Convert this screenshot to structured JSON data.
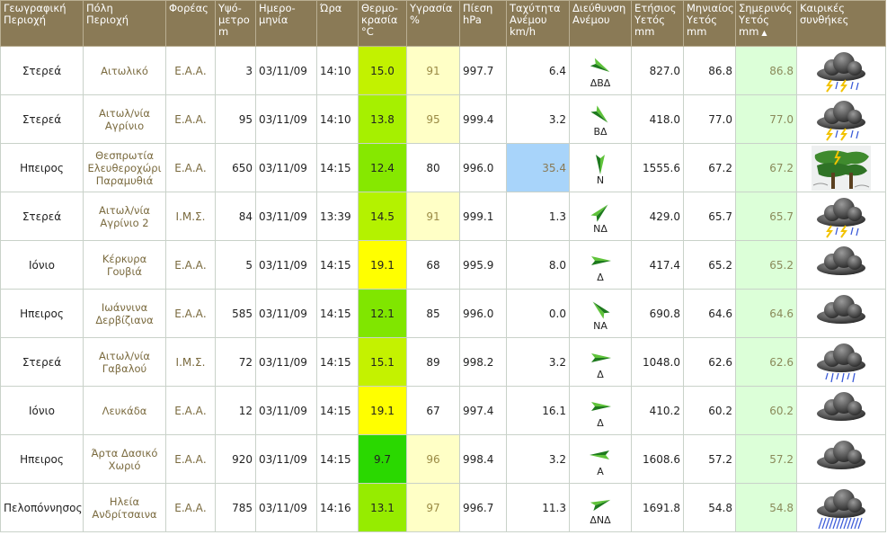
{
  "headers": [
    {
      "l1": "Γεωγραφική",
      "l2": "Περιοχή"
    },
    {
      "l1": "Πόλη",
      "l2": "Περιοχή"
    },
    {
      "l1": "Φορέας",
      "l2": ""
    },
    {
      "l1": "Υψό-",
      "l2": "μετρο",
      "l3": "m"
    },
    {
      "l1": "Ημερο-",
      "l2": "μηνία"
    },
    {
      "l1": "Ώρα",
      "l2": ""
    },
    {
      "l1": "Θερμο-",
      "l2": "κρασία",
      "l3": "°C"
    },
    {
      "l1": "Υγρασία",
      "l2": "",
      "l3": "%"
    },
    {
      "l1": "Πίεση",
      "l2": "",
      "l3": "hPa"
    },
    {
      "l1": "Ταχύτητα",
      "l2": "Ανέμου",
      "l3": "km/h"
    },
    {
      "l1": "Διεύθυνση",
      "l2": "Ανέμου"
    },
    {
      "l1": "Ετήσιος",
      "l2": "Υετός",
      "l3": "mm"
    },
    {
      "l1": "Μηνιαίος",
      "l2": "Υετός",
      "l3": "mm"
    },
    {
      "l1": "Σημερινός",
      "l2": "Υετός",
      "l3": "mm",
      "arrow": "▲"
    },
    {
      "l1": "Καιρικές",
      "l2": "συνθήκες"
    }
  ],
  "rows": [
    {
      "region": "Στερεά",
      "city": "Αιτωλικό",
      "agency": "Ε.Α.Α.",
      "alt": "3",
      "date": "03/11/09",
      "time": "14:10",
      "temp": "15.0",
      "tempColor": "#c2f200",
      "hum": "91",
      "humHi": true,
      "pres": "997.7",
      "wind": "6.4",
      "windHi": false,
      "dir": "ΔΒΔ",
      "dirDeg": 300,
      "yearly": "827.0",
      "monthly": "86.8",
      "today": "86.8",
      "wx": "storm"
    },
    {
      "region": "Στερεά",
      "city": "Αιτωλ/νία Αγρίνιο",
      "agency": "Ε.Α.Α.",
      "alt": "95",
      "date": "03/11/09",
      "time": "14:10",
      "temp": "13.8",
      "tempColor": "#a6f000",
      "hum": "95",
      "humHi": true,
      "pres": "999.4",
      "wind": "3.2",
      "windHi": false,
      "dir": "ΒΔ",
      "dirDeg": 315,
      "yearly": "418.0",
      "monthly": "77.0",
      "today": "77.0",
      "wx": "storm"
    },
    {
      "region": "Ηπειρος",
      "city": "Θεσπρωτία Ελευθεροχώρι Παραμυθιά",
      "agency": "Ε.Α.Α.",
      "alt": "650",
      "date": "03/11/09",
      "time": "14:15",
      "temp": "12.4",
      "tempColor": "#86e800",
      "hum": "80",
      "humHi": false,
      "pres": "996.0",
      "wind": "35.4",
      "windHi": true,
      "dir": "Ν",
      "dirDeg": 0,
      "yearly": "1555.6",
      "monthly": "67.2",
      "today": "67.2",
      "wx": "windstorm"
    },
    {
      "region": "Στερεά",
      "city": "Αιτωλ/νία Αγρίνιο 2",
      "agency": "Ι.Μ.Σ.",
      "alt": "84",
      "date": "03/11/09",
      "time": "13:39",
      "temp": "14.5",
      "tempColor": "#b4f200",
      "hum": "91",
      "humHi": true,
      "pres": "999.1",
      "wind": "1.3",
      "windHi": false,
      "dir": "ΝΔ",
      "dirDeg": 225,
      "yearly": "429.0",
      "monthly": "65.7",
      "today": "65.7",
      "wx": "storm"
    },
    {
      "region": "Ιόνιο",
      "city": "Κέρκυρα Γουβιά",
      "agency": "Ε.Α.Α.",
      "alt": "5",
      "date": "03/11/09",
      "time": "14:15",
      "temp": "19.1",
      "tempColor": "#ffff00",
      "hum": "68",
      "humHi": false,
      "pres": "995.9",
      "wind": "8.0",
      "windHi": false,
      "dir": "Δ",
      "dirDeg": 270,
      "yearly": "417.4",
      "monthly": "65.2",
      "today": "65.2",
      "wx": "cloud"
    },
    {
      "region": "Ηπειρος",
      "city": "Ιωάννινα Δερβίζιανα",
      "agency": "Ε.Α.Α.",
      "alt": "585",
      "date": "03/11/09",
      "time": "14:15",
      "temp": "12.1",
      "tempColor": "#80e600",
      "hum": "85",
      "humHi": false,
      "pres": "996.0",
      "wind": "0.0",
      "windHi": false,
      "dir": "ΝΑ",
      "dirDeg": 135,
      "yearly": "690.8",
      "monthly": "64.6",
      "today": "64.6",
      "wx": "cloud"
    },
    {
      "region": "Στερεά",
      "city": "Αιτωλ/νία Γαβαλού",
      "agency": "Ι.Μ.Σ.",
      "alt": "72",
      "date": "03/11/09",
      "time": "14:15",
      "temp": "15.1",
      "tempColor": "#c4f200",
      "hum": "89",
      "humHi": false,
      "pres": "998.2",
      "wind": "3.2",
      "windHi": false,
      "dir": "Δ",
      "dirDeg": 270,
      "yearly": "1048.0",
      "monthly": "62.6",
      "today": "62.6",
      "wx": "rain"
    },
    {
      "region": "Ιόνιο",
      "city": "Λευκάδα",
      "agency": "Ε.Α.Α.",
      "alt": "12",
      "date": "03/11/09",
      "time": "14:15",
      "temp": "19.1",
      "tempColor": "#ffff00",
      "hum": "67",
      "humHi": false,
      "pres": "997.4",
      "wind": "16.1",
      "windHi": false,
      "dir": "Δ",
      "dirDeg": 270,
      "yearly": "410.2",
      "monthly": "60.2",
      "today": "60.2",
      "wx": "cloud"
    },
    {
      "region": "Ηπειρος",
      "city": "Άρτα Δασικό Χωριό",
      "agency": "Ε.Α.Α.",
      "alt": "920",
      "date": "03/11/09",
      "time": "14:15",
      "temp": "9.7",
      "tempColor": "#2ad800",
      "hum": "96",
      "humHi": true,
      "pres": "998.4",
      "wind": "3.2",
      "windHi": false,
      "dir": "Α",
      "dirDeg": 90,
      "yearly": "1608.6",
      "monthly": "57.2",
      "today": "57.2",
      "wx": "cloud"
    },
    {
      "region": "Πελοπόννησος",
      "city": "Ηλεία Ανδρίτσαινα",
      "agency": "Ε.Α.Α.",
      "alt": "785",
      "date": "03/11/09",
      "time": "14:16",
      "temp": "13.1",
      "tempColor": "#96ec00",
      "hum": "97",
      "humHi": true,
      "pres": "996.7",
      "wind": "11.3",
      "windHi": false,
      "dir": "ΔΝΔ",
      "dirDeg": 250,
      "yearly": "1691.8",
      "monthly": "54.8",
      "today": "54.8",
      "wx": "heavyrain"
    }
  ],
  "icons": {
    "storm": "thunderstorm-icon",
    "windstorm": "windstorm-icon",
    "cloud": "cloud-icon",
    "rain": "rain-icon",
    "heavyrain": "heavy-rain-icon",
    "arrow": "wind-arrow-icon"
  },
  "colors": {
    "header_bg": "#8a7a56",
    "humidity_highlight": "#ffffc6",
    "wind_highlight": "#a8d4fa",
    "today_rain_bg": "#dcffd8",
    "arrow_green": "#2e9b2e"
  }
}
